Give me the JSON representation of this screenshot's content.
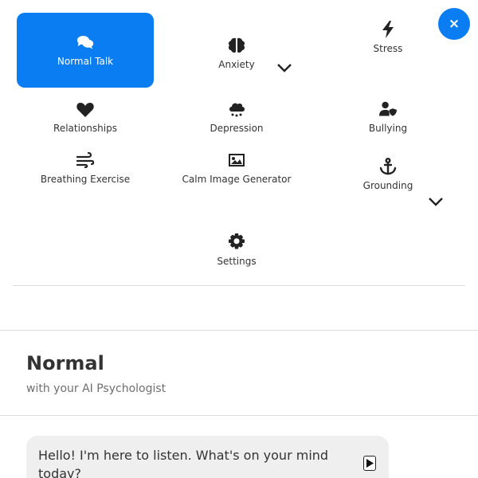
{
  "menu": {
    "items": [
      {
        "label": "Normal Talk",
        "icon": "chat-bubbles-icon",
        "active": true
      },
      {
        "label": "Anxiety",
        "icon": "brain-icon"
      },
      {
        "label": "Stress",
        "icon": "lightning-bolt-icon"
      },
      {
        "label": "Relationships",
        "icon": "heart-icon"
      },
      {
        "label": "Depression",
        "icon": "rain-cloud-icon"
      },
      {
        "label": "Bullying",
        "icon": "user-shield-icon"
      },
      {
        "label": "Breathing Exercise",
        "icon": "wind-icon"
      },
      {
        "label": "Calm Image Generator",
        "icon": "image-icon"
      },
      {
        "label": "Grounding",
        "icon": "anchor-icon"
      },
      {
        "label": "Settings",
        "icon": "gear-icon"
      }
    ]
  },
  "close_button": {
    "label": "×",
    "icon": "close-icon"
  },
  "chat": {
    "title": "Normal",
    "subtitle": "with your AI Psychologist",
    "first_message": "Hello! I'm here to listen. What's on your mind today?"
  },
  "colors": {
    "accent": "#0a7df2",
    "bubble": "#efefef",
    "divider": "#dddddd"
  }
}
